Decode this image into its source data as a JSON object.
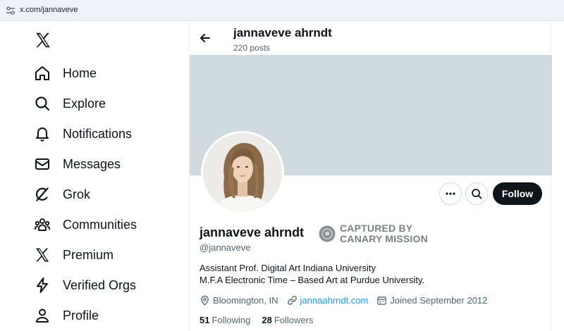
{
  "browser": {
    "url": "x.com/jannaveve"
  },
  "sidebar": {
    "items": [
      {
        "label": "Home",
        "icon": "home-icon"
      },
      {
        "label": "Explore",
        "icon": "search-icon"
      },
      {
        "label": "Notifications",
        "icon": "bell-icon"
      },
      {
        "label": "Messages",
        "icon": "envelope-icon"
      },
      {
        "label": "Grok",
        "icon": "grok-icon"
      },
      {
        "label": "Communities",
        "icon": "communities-icon"
      },
      {
        "label": "Premium",
        "icon": "x-logo-icon"
      },
      {
        "label": "Verified Orgs",
        "icon": "lightning-icon"
      },
      {
        "label": "Profile",
        "icon": "person-icon"
      }
    ]
  },
  "header": {
    "name": "jannaveve ahrndt",
    "posts": "220 posts"
  },
  "profile": {
    "name": "jannaveve ahrndt",
    "handle": "@jannaveve",
    "bio_line1": "Assistant Prof. Digital Art Indiana University",
    "bio_line2": "M.F.A  Electronic Time – Based Art at Purdue University.",
    "location": "Bloomington, IN",
    "website": "jannaahrndt.com",
    "joined": "Joined September 2012",
    "following_count": "51",
    "following_label": "Following",
    "followers_count": "28",
    "followers_label": "Followers"
  },
  "actions": {
    "follow_label": "Follow"
  },
  "watermark": {
    "line1": "CAPTURED BY",
    "line2": "CANARY MISSION"
  },
  "colors": {
    "banner": "#cfd9de",
    "link": "#1d9bf0",
    "text": "#0f1419",
    "secondary": "#536471"
  }
}
